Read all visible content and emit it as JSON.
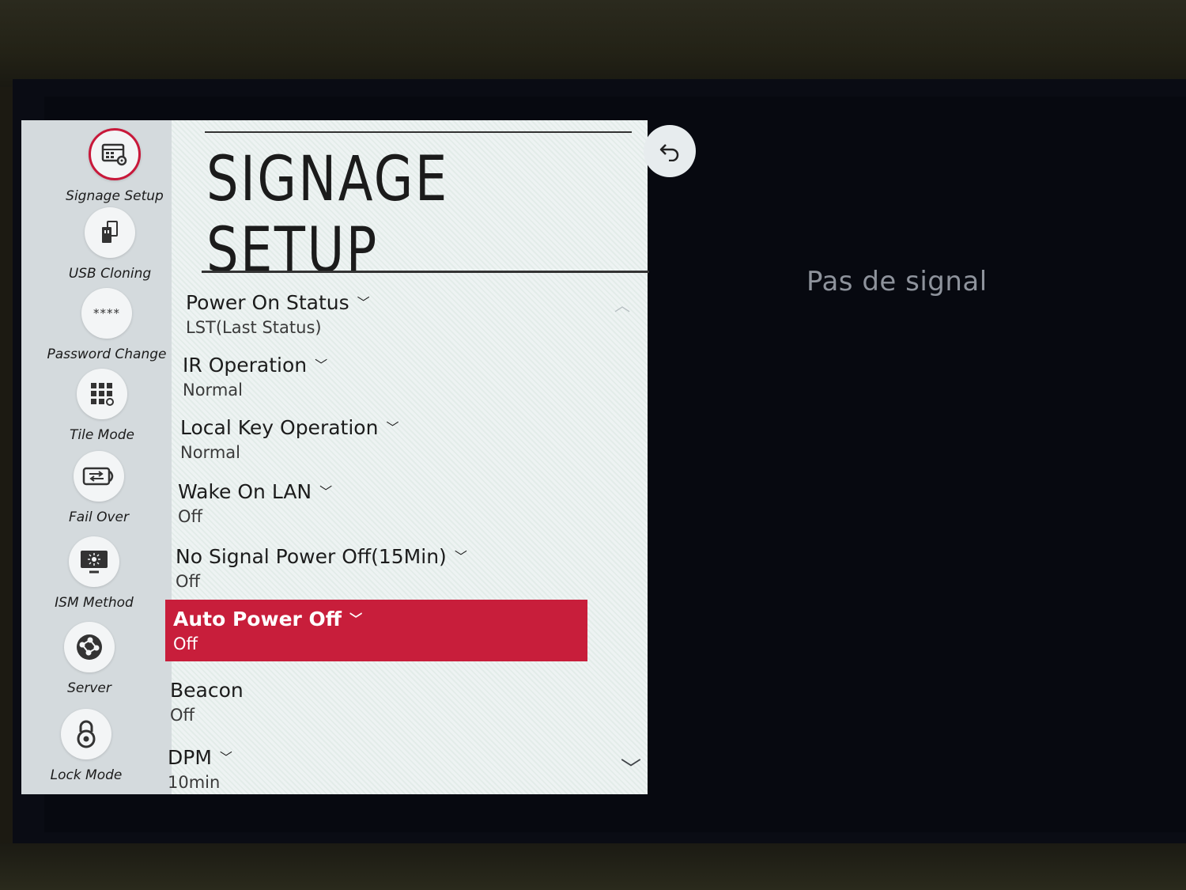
{
  "screen": {
    "no_signal_text": "Pas de signal"
  },
  "menu": {
    "title": "SIGNAGE SETUP",
    "back_icon": "back-arrow-icon",
    "accent_color": "#c81e3b",
    "sidebar": {
      "items": [
        {
          "label": "Signage Setup",
          "icon": "signage-setup-icon",
          "active": true
        },
        {
          "label": "USB Cloning",
          "icon": "usb-cloning-icon",
          "active": false
        },
        {
          "label": "Password Change",
          "icon": "password-icon",
          "glyph": "****",
          "active": false
        },
        {
          "label": "Tile Mode",
          "icon": "tile-mode-icon",
          "active": false
        },
        {
          "label": "Fail Over",
          "icon": "fail-over-icon",
          "active": false
        },
        {
          "label": "ISM Method",
          "icon": "ism-method-icon",
          "active": false
        },
        {
          "label": "Server",
          "icon": "server-icon",
          "active": false
        },
        {
          "label": "Lock Mode",
          "icon": "lock-icon",
          "active": false
        }
      ]
    },
    "settings": [
      {
        "title": "Power On Status",
        "value": "LST(Last Status)",
        "has_dropdown": true,
        "selected": false
      },
      {
        "title": "IR Operation",
        "value": "Normal",
        "has_dropdown": true,
        "selected": false
      },
      {
        "title": "Local Key Operation",
        "value": "Normal",
        "has_dropdown": true,
        "selected": false
      },
      {
        "title": "Wake On LAN",
        "value": "Off",
        "has_dropdown": true,
        "selected": false
      },
      {
        "title": "No Signal Power Off(15Min)",
        "value": "Off",
        "has_dropdown": true,
        "selected": false
      },
      {
        "title": "Auto Power Off",
        "value": "Off",
        "has_dropdown": true,
        "selected": true
      },
      {
        "title": "Beacon",
        "value": "Off",
        "has_dropdown": false,
        "selected": false
      },
      {
        "title": "DPM",
        "value": "10min",
        "has_dropdown": true,
        "selected": false
      }
    ]
  }
}
